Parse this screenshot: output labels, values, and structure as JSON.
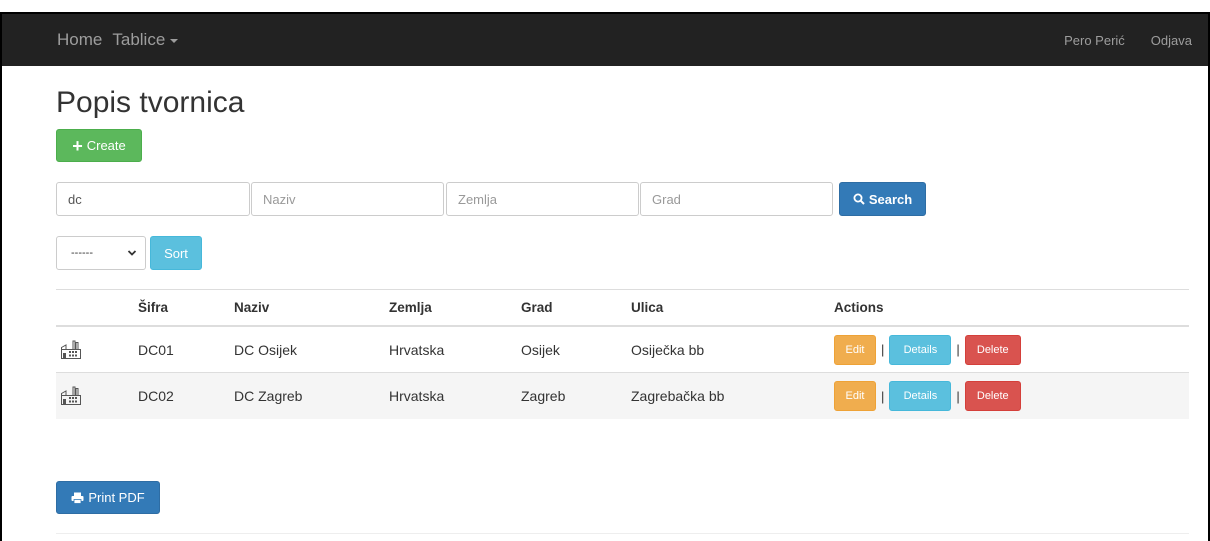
{
  "navbar": {
    "home": "Home",
    "tables": "Tablice",
    "user": "Pero Perić",
    "logout": "Odjava"
  },
  "page": {
    "title": "Popis tvornica",
    "create_label": "Create"
  },
  "filters": {
    "sifra_value": "dc",
    "naziv_placeholder": "Naziv",
    "zemlja_placeholder": "Zemlja",
    "grad_placeholder": "Grad",
    "search_label": "Search",
    "sort_selected": "------",
    "sort_label": "Sort"
  },
  "table": {
    "headers": [
      "Šifra",
      "Naziv",
      "Zemlja",
      "Grad",
      "Ulica",
      "Actions"
    ],
    "rows": [
      {
        "sifra": "DC01",
        "naziv": "DC Osijek",
        "zemlja": "Hrvatska",
        "grad": "Osijek",
        "ulica": "Osiječka bb"
      },
      {
        "sifra": "DC02",
        "naziv": "DC Zagreb",
        "zemlja": "Hrvatska",
        "grad": "Zagreb",
        "ulica": "Zagrebačka bb"
      }
    ],
    "actions": {
      "edit": "Edit",
      "details": "Details",
      "delete": "Delete",
      "separator": "|"
    }
  },
  "footer": {
    "print_label": "Print PDF"
  },
  "colors": {
    "navbar": "#222222",
    "success": "#5cb85c",
    "primary": "#337ab7",
    "info": "#5bc0de",
    "warning": "#f0ad4e",
    "danger": "#d9534f"
  },
  "icons": {
    "row_icon": "factory-icon",
    "search": "search-icon",
    "create": "plus-icon",
    "print": "printer-icon",
    "select": "chevron-down-icon"
  }
}
